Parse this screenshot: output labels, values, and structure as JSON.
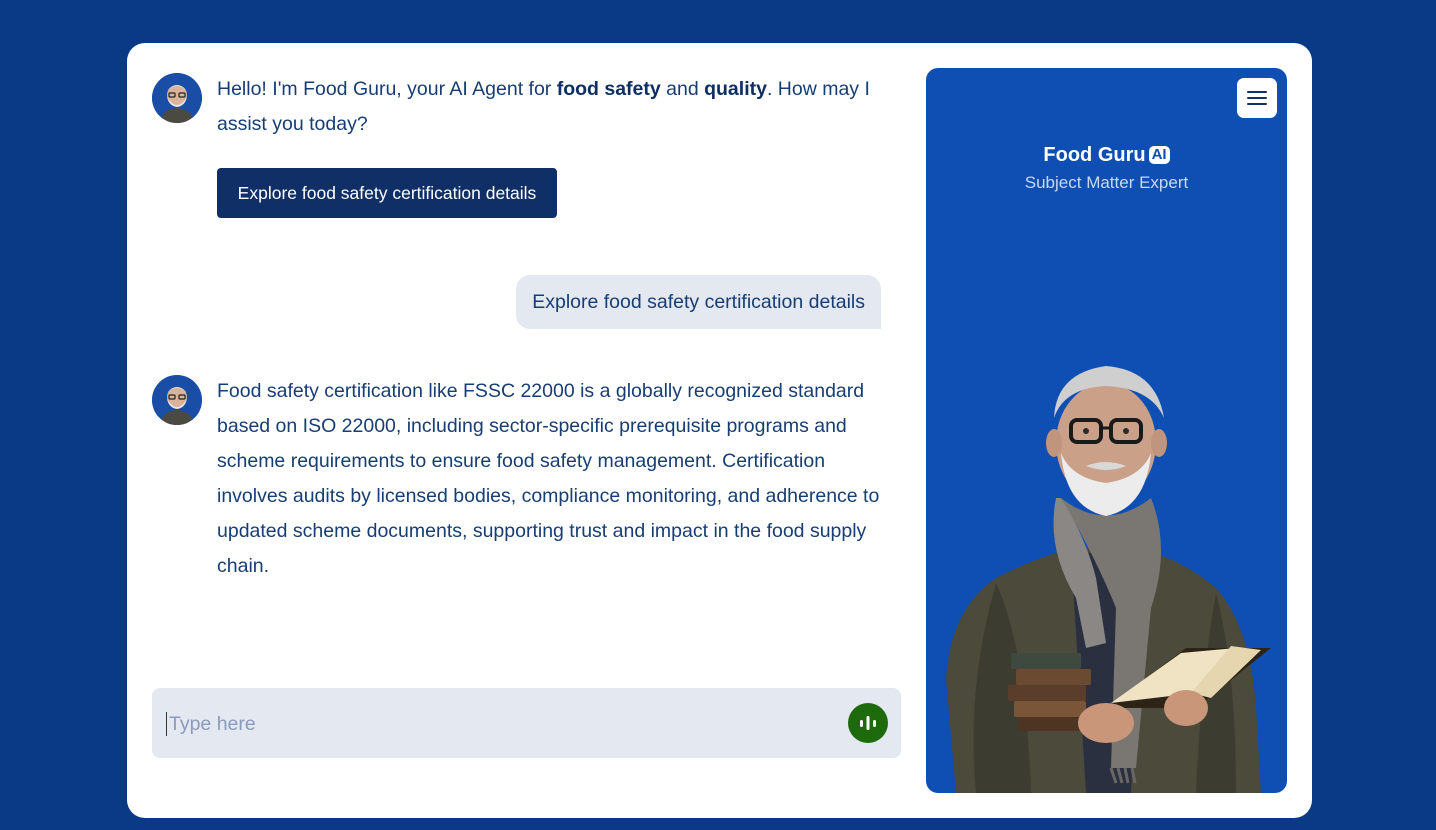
{
  "chat": {
    "greeting": {
      "part1": "Hello! I'm Food Guru, your AI Agent for ",
      "bold1": "food safety",
      "part2": " and ",
      "bold2": "quality",
      "part3": ". How may I assist you today?"
    },
    "suggestion_button": "Explore food safety certification details",
    "user_message": "Explore food safety certification details",
    "answer": "Food safety certification like FSSC 22000 is a globally recognized standard based on ISO 22000, including sector-specific prerequisite programs and scheme requirements to ensure food safety management. Certification involves audits by licensed bodies, compliance monitoring, and adherence to updated scheme documents, supporting trust and impact in the food supply chain."
  },
  "input": {
    "placeholder": "Type here",
    "value": ""
  },
  "panel": {
    "title": "Food Guru",
    "badge": "AI",
    "subtitle": "Subject Matter Expert"
  },
  "icons": {
    "menu": "hamburger-menu-icon",
    "voice": "audio-waveform-icon",
    "avatar": "bot-avatar-icon"
  },
  "colors": {
    "background": "#0a3a85",
    "panel": "#0f4fb3",
    "button": "#0f2f66",
    "voice": "#1d6b0c",
    "text": "#173e74"
  }
}
